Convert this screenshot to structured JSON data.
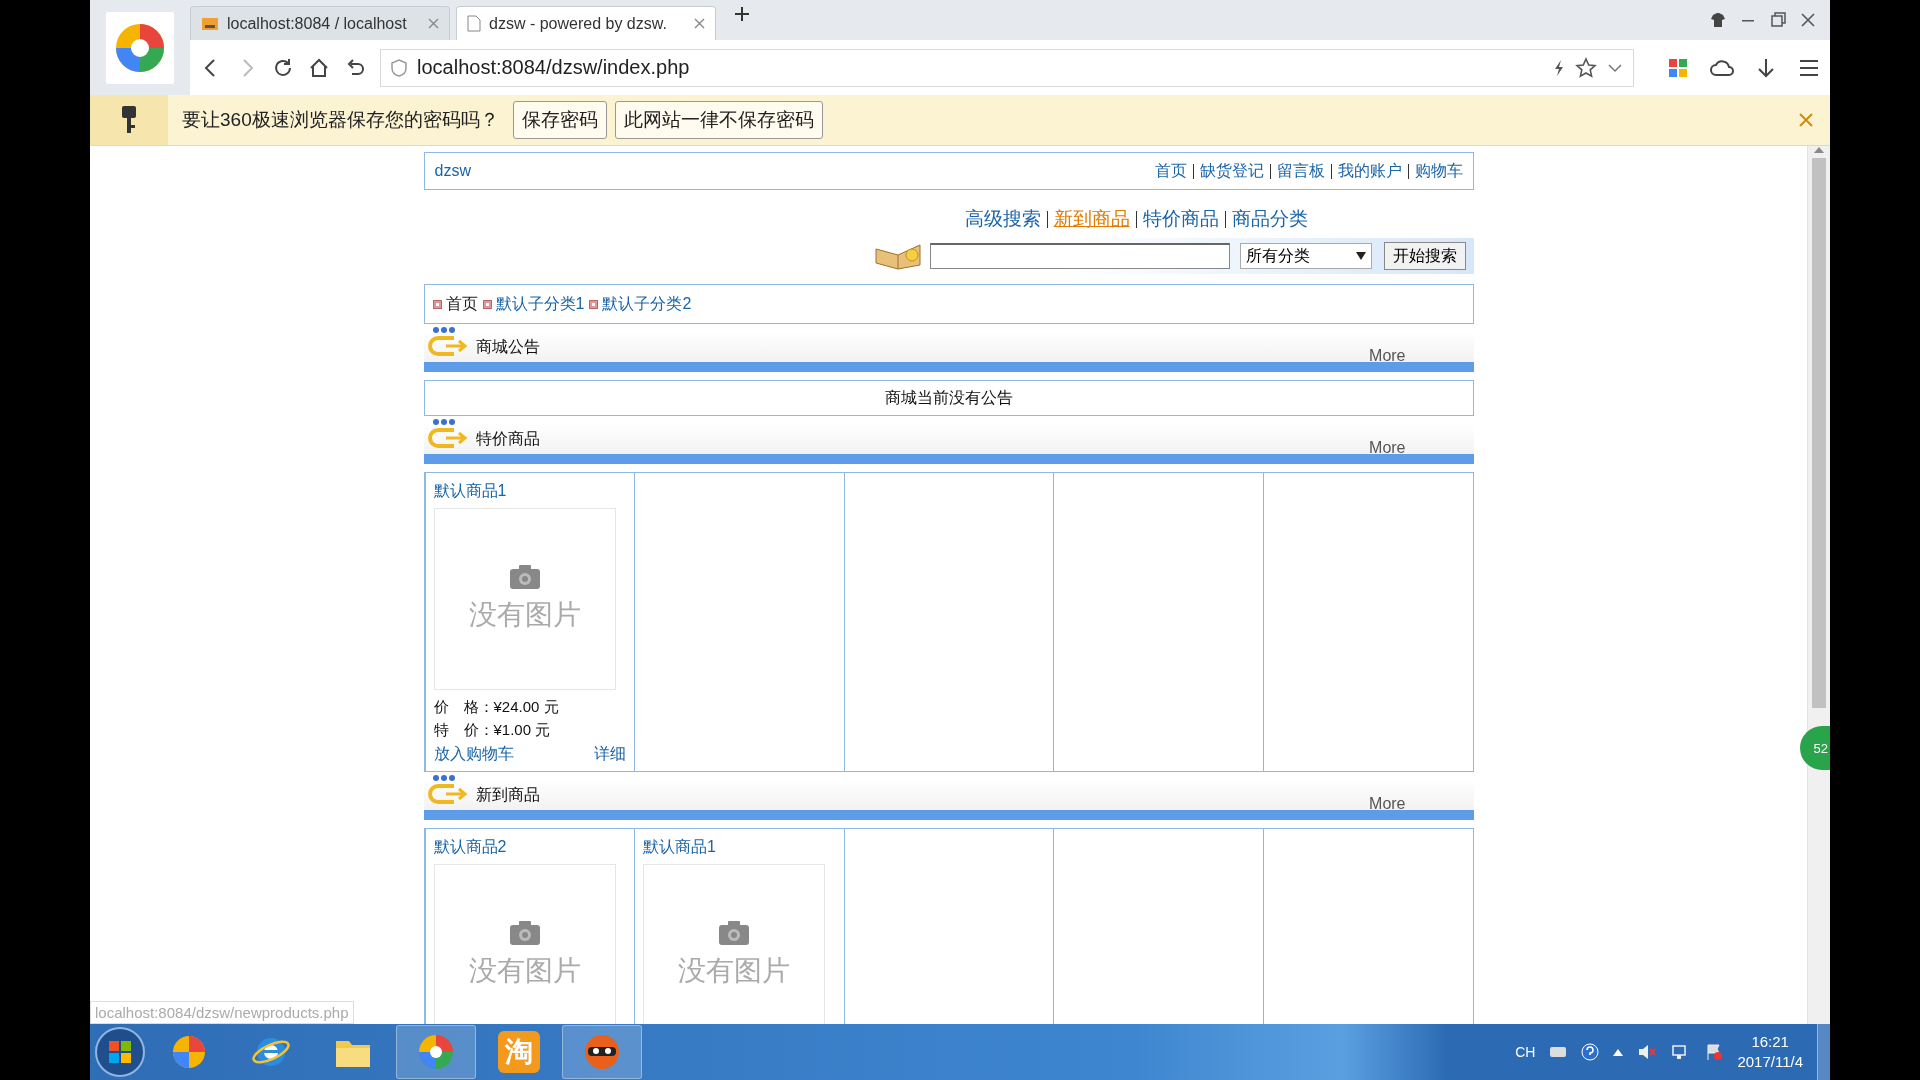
{
  "browser": {
    "tabs": [
      {
        "title": "localhost:8084 / localhost",
        "selected": false
      },
      {
        "title": "dzsw - powered by dzsw.",
        "selected": true
      }
    ],
    "address": "localhost:8084/dzsw/index.php"
  },
  "password_bar": {
    "message": "要让360极速浏览器保存您的密码吗？",
    "buttons": [
      "保存密码",
      "此网站一律不保存密码"
    ]
  },
  "site": {
    "name": "dzsw",
    "top_nav": [
      "首页",
      "缺货登记",
      "留言板",
      "我的账户",
      "购物车"
    ],
    "sub_nav": [
      {
        "label": "高级搜索",
        "hovered": false
      },
      {
        "label": "新到商品",
        "hovered": true
      },
      {
        "label": "特价商品",
        "hovered": false
      },
      {
        "label": "商品分类",
        "hovered": false
      }
    ],
    "search": {
      "category": "所有分类",
      "button": "开始搜索"
    },
    "categories": [
      "首页",
      "默认子分类1",
      "默认子分类2"
    ],
    "sections": [
      {
        "kind": "notice",
        "title": "商城公告",
        "more": "More",
        "notice": "商城当前没有公告"
      },
      {
        "kind": "products",
        "title": "特价商品",
        "more": "More",
        "products": [
          {
            "name": "默认商品1",
            "no_image": "没有图片",
            "price": "价　格：¥24.00 元",
            "special": "特　价：¥1.00 元",
            "cart": "放入购物车",
            "detail": "详细"
          }
        ]
      },
      {
        "kind": "products",
        "title": "新到商品",
        "more": "More",
        "products": [
          {
            "name": "默认商品2",
            "no_image": "没有图片"
          },
          {
            "name": "默认商品1",
            "no_image": "没有图片"
          }
        ]
      }
    ]
  },
  "status_bar": "localhost:8084/dzsw/newproducts.php",
  "side_badge": "52",
  "taskbar": {
    "apps": [
      {
        "kind": "orb"
      },
      {
        "kind": "ie"
      },
      {
        "kind": "folder"
      },
      {
        "kind": "browser360"
      },
      {
        "kind": "taobao",
        "label": "淘"
      },
      {
        "kind": "ninja"
      }
    ],
    "language": "CH",
    "time": "16:21",
    "date": "2017/11/4"
  }
}
